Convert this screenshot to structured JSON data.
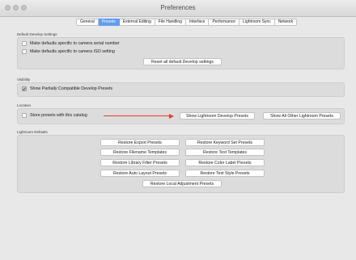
{
  "window": {
    "title": "Preferences"
  },
  "tabs": [
    {
      "label": "General"
    },
    {
      "label": "Presets",
      "active": true
    },
    {
      "label": "External Editing"
    },
    {
      "label": "File Handling"
    },
    {
      "label": "Interface"
    },
    {
      "label": "Performance"
    },
    {
      "label": "Lightroom Sync"
    },
    {
      "label": "Network"
    }
  ],
  "default_develop": {
    "label": "Default Develop Settings",
    "serial_checkbox": {
      "label": "Make defaults specific to camera serial number",
      "checked": false
    },
    "iso_checkbox": {
      "label": "Make defaults specific to camera ISO setting",
      "checked": false
    },
    "reset_button": "Reset all default Develop settings"
  },
  "visibility": {
    "label": "Visibility",
    "partial_checkbox": {
      "label": "Show Partially Compatible Develop Presets",
      "checked": true
    }
  },
  "location": {
    "label": "Location",
    "store_checkbox": {
      "label": "Store presets with this catalog",
      "checked": false
    },
    "show_develop_button": "Show Lightroom Develop Presets",
    "show_other_button": "Show All Other Lightroom Presets",
    "arrow_color": "#e23b2a"
  },
  "lightroom_defaults": {
    "label": "Lightroom Defaults",
    "buttons": {
      "export": "Restore Export Presets",
      "keyword": "Restore Keyword Set Presets",
      "filename": "Restore Filename Templates",
      "text_templates": "Restore Text Templates",
      "library_filter": "Restore Library Filter Presets",
      "color_label": "Restore Color Label Presets",
      "auto_layout": "Restore Auto Layout Presets",
      "text_style": "Restore Text Style Presets",
      "local_adjustment": "Restore Local Adjustment Presets"
    }
  },
  "colors": {
    "accent": "#5d9ff5",
    "window_bg": "#e8e8e8",
    "group_bg": "#dcdcdc"
  }
}
